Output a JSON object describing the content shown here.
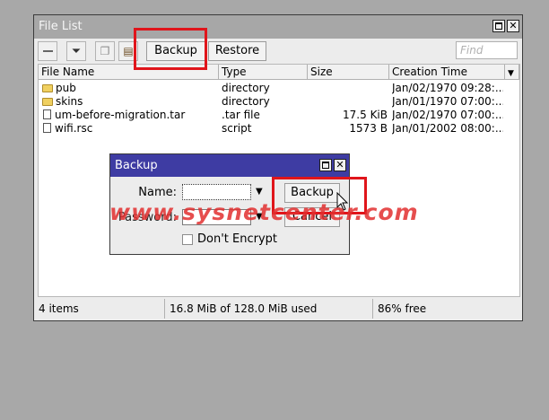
{
  "window": {
    "title": "File List",
    "toolbar": {
      "backup_label": "Backup",
      "restore_label": "Restore",
      "find_placeholder": "Find"
    },
    "columns": [
      "File Name",
      "Type",
      "Size",
      "Creation Time"
    ],
    "rows": [
      {
        "name": "pub",
        "type": "directory",
        "size": "",
        "time": "Jan/02/1970 09:28:...",
        "icon": "folder-icon"
      },
      {
        "name": "skins",
        "type": "directory",
        "size": "",
        "time": "Jan/01/1970 07:00:...",
        "icon": "folder-icon"
      },
      {
        "name": "um-before-migration.tar",
        "type": ".tar file",
        "size": "17.5 KiB",
        "time": "Jan/02/1970 07:00:...",
        "icon": "file-icon"
      },
      {
        "name": "wifi.rsc",
        "type": "script",
        "size": "1573 B",
        "time": "Jan/01/2002 08:00:...",
        "icon": "file-icon"
      }
    ],
    "status": {
      "items": "4 items",
      "used": "16.8 MiB of 128.0 MiB used",
      "free": "86% free"
    }
  },
  "dialog": {
    "title": "Backup",
    "name_label": "Name:",
    "name_value": "",
    "password_label": "Password:",
    "password_value": "",
    "backup_label": "Backup",
    "cancel_label": "Cancel",
    "dont_encrypt_label": "Don't Encrypt"
  },
  "watermark": "www.sysnetcenter.com"
}
